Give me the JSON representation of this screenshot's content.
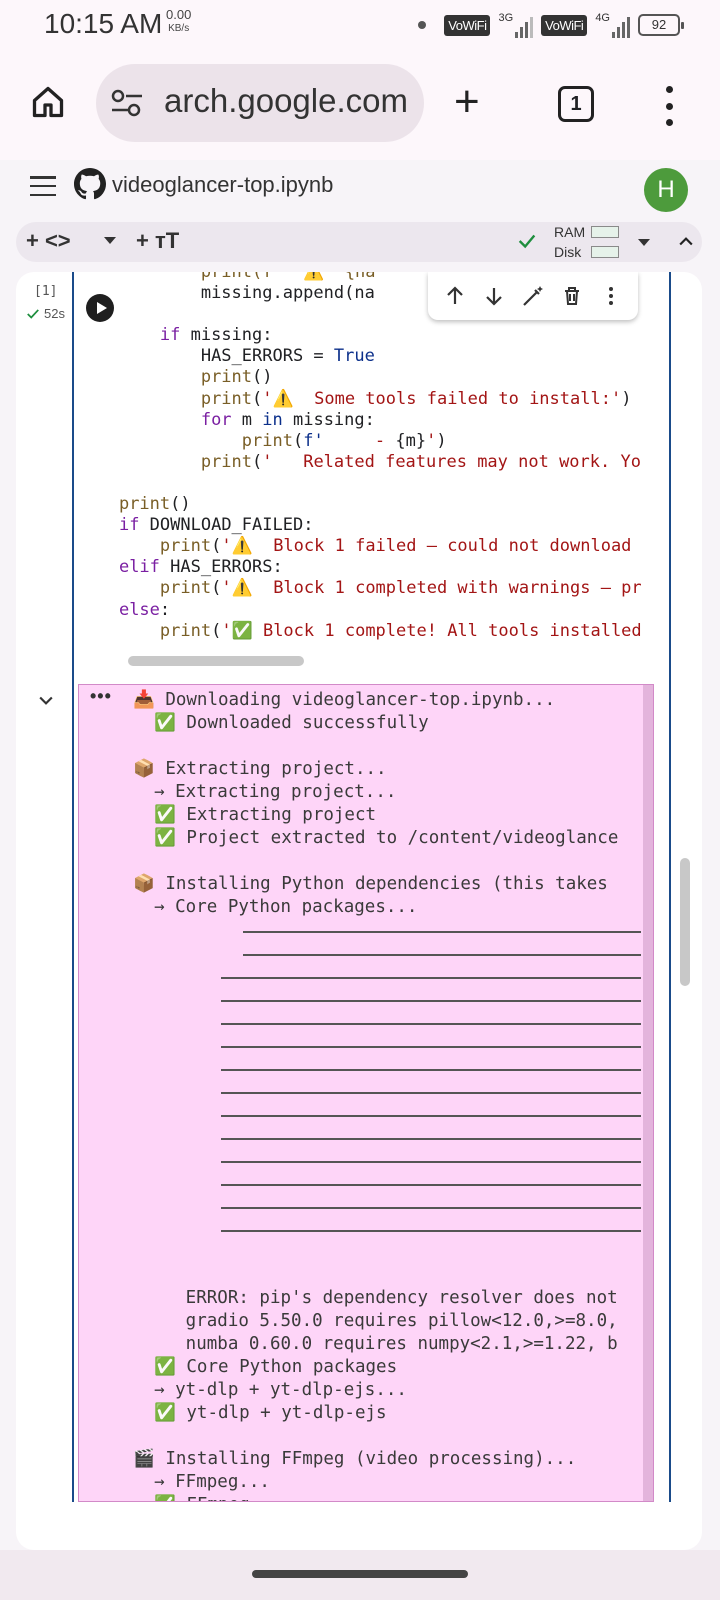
{
  "status_bar": {
    "time": "10:15 AM",
    "speed_value": "0.00",
    "speed_unit": "KB/s",
    "vowifi_1": "VoWiFi",
    "net_1": "3G",
    "vowifi_2": "VoWiFi",
    "net_2": "4G",
    "battery": "92"
  },
  "browser": {
    "url": "arch.google.com",
    "new_tab": "+",
    "tab_count": "1"
  },
  "colab": {
    "notebook_title": "videoglancer-top.ipynb",
    "avatar_letter": "H",
    "toolbar": {
      "add_code": "+ <>",
      "add_text": "+ тT",
      "ram_label": "RAM",
      "disk_label": "Disk"
    },
    "cell": {
      "exec_count": "[1]",
      "elapsed": "52s",
      "code_lines": [
        {
          "indent": "            ",
          "parts": [
            {
              "t": "print(f'  ⚠️  {na",
              "c": "fn"
            }
          ]
        },
        {
          "indent": "            ",
          "parts": [
            {
              "t": "missing.append(na",
              "c": ""
            }
          ]
        },
        {
          "indent": "",
          "parts": []
        },
        {
          "indent": "        ",
          "parts": [
            {
              "t": "if",
              "c": "kw"
            },
            {
              "t": " missing:",
              "c": ""
            }
          ]
        },
        {
          "indent": "            ",
          "parts": [
            {
              "t": "HAS_ERRORS = ",
              "c": ""
            },
            {
              "t": "True",
              "c": "cst"
            }
          ]
        },
        {
          "indent": "            ",
          "parts": [
            {
              "t": "print",
              "c": "fn"
            },
            {
              "t": "()",
              "c": ""
            }
          ]
        },
        {
          "indent": "            ",
          "parts": [
            {
              "t": "print",
              "c": "fn"
            },
            {
              "t": "(",
              "c": ""
            },
            {
              "t": "'⚠️  Some tools failed to install:'",
              "c": "str"
            },
            {
              "t": ")",
              "c": ""
            }
          ]
        },
        {
          "indent": "            ",
          "parts": [
            {
              "t": "for",
              "c": "kw"
            },
            {
              "t": " m ",
              "c": ""
            },
            {
              "t": "in",
              "c": "kw2"
            },
            {
              "t": " missing:",
              "c": ""
            }
          ]
        },
        {
          "indent": "                ",
          "parts": [
            {
              "t": "print",
              "c": "fn"
            },
            {
              "t": "(",
              "c": ""
            },
            {
              "t": "f'",
              "c": "kw2"
            },
            {
              "t": "     - ",
              "c": "str"
            },
            {
              "t": "{m}",
              "c": ""
            },
            {
              "t": "'",
              "c": "str"
            },
            {
              "t": ")",
              "c": ""
            }
          ]
        },
        {
          "indent": "            ",
          "parts": [
            {
              "t": "print",
              "c": "fn"
            },
            {
              "t": "(",
              "c": ""
            },
            {
              "t": "'   Related features may not work. Yo",
              "c": "str"
            }
          ]
        },
        {
          "indent": "",
          "parts": []
        },
        {
          "indent": "    ",
          "parts": [
            {
              "t": "print",
              "c": "fn"
            },
            {
              "t": "()",
              "c": ""
            }
          ]
        },
        {
          "indent": "    ",
          "parts": [
            {
              "t": "if",
              "c": "kw"
            },
            {
              "t": " DOWNLOAD_FAILED:",
              "c": ""
            }
          ]
        },
        {
          "indent": "        ",
          "parts": [
            {
              "t": "print",
              "c": "fn"
            },
            {
              "t": "(",
              "c": ""
            },
            {
              "t": "'⚠️  Block 1 failed — could not download ",
              "c": "str"
            }
          ]
        },
        {
          "indent": "    ",
          "parts": [
            {
              "t": "elif",
              "c": "kw"
            },
            {
              "t": " HAS_ERRORS:",
              "c": ""
            }
          ]
        },
        {
          "indent": "        ",
          "parts": [
            {
              "t": "print",
              "c": "fn"
            },
            {
              "t": "(",
              "c": ""
            },
            {
              "t": "'⚠️  Block 1 completed with warnings — pr",
              "c": "str"
            }
          ]
        },
        {
          "indent": "    ",
          "parts": [
            {
              "t": "else",
              "c": "kw"
            },
            {
              "t": ":",
              "c": ""
            }
          ]
        },
        {
          "indent": "        ",
          "parts": [
            {
              "t": "print",
              "c": "fn"
            },
            {
              "t": "(",
              "c": ""
            },
            {
              "t": "'✅ Block 1 complete! All tools installed",
              "c": "str"
            }
          ]
        }
      ]
    },
    "output": {
      "dots": "•••",
      "lines": [
        "📥 Downloading videoglancer-top.ipynb...",
        "  ✅ Downloaded successfully",
        "",
        "📦 Extracting project...",
        "  → Extracting project...",
        "  ✅ Extracting project",
        "  ✅ Project extracted to /content/videoglance",
        "",
        "📦 Installing Python dependencies (this takes",
        "  → Core Python packages...",
        "",
        "",
        "",
        "",
        "",
        "",
        "",
        "",
        "",
        "",
        "",
        "",
        "",
        "",
        "",
        "",
        "     ERROR: pip's dependency resolver does not",
        "     gradio 5.50.0 requires pillow<12.0,>=8.0,",
        "     numba 0.60.0 requires numpy<2.1,>=1.22, b",
        "  ✅ Core Python packages",
        "  → yt-dlp + yt-dlp-ejs...",
        "  ✅ yt-dlp + yt-dlp-ejs",
        "",
        "🎬 Installing FFmpeg (video processing)...",
        "  → FFmpeg...",
        "  ✅ FFmpeg"
      ]
    }
  }
}
